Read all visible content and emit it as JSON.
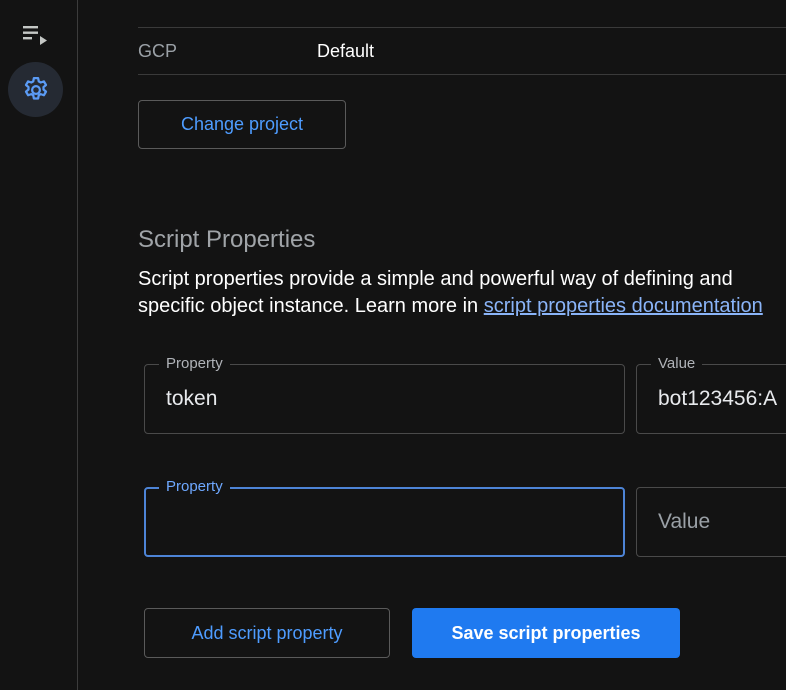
{
  "sidebar": {
    "icons": [
      {
        "name": "list-play-icon"
      },
      {
        "name": "gear-icon",
        "selected": true
      }
    ]
  },
  "project": {
    "label": "GCP",
    "value": "Default",
    "change_button": "Change project"
  },
  "script_properties": {
    "title": "Script Properties",
    "description_line1": "Script properties provide a simple and powerful way of defining and",
    "description_line2_prefix": "specific object instance. Learn more in ",
    "link_text": "script properties documentation",
    "rows": [
      {
        "property_label": "Property",
        "property_value": "token",
        "value_label": "Value",
        "value": "bot123456:A"
      },
      {
        "property_label": "Property",
        "property_value": "",
        "value_placeholder": "Value",
        "focused": true
      }
    ],
    "add_button": "Add script property",
    "save_button": "Save script properties"
  },
  "colors": {
    "background": "#131313",
    "accent": "#1f7af0",
    "link": "#8ab4f8",
    "focus_border": "#4d84d6"
  }
}
